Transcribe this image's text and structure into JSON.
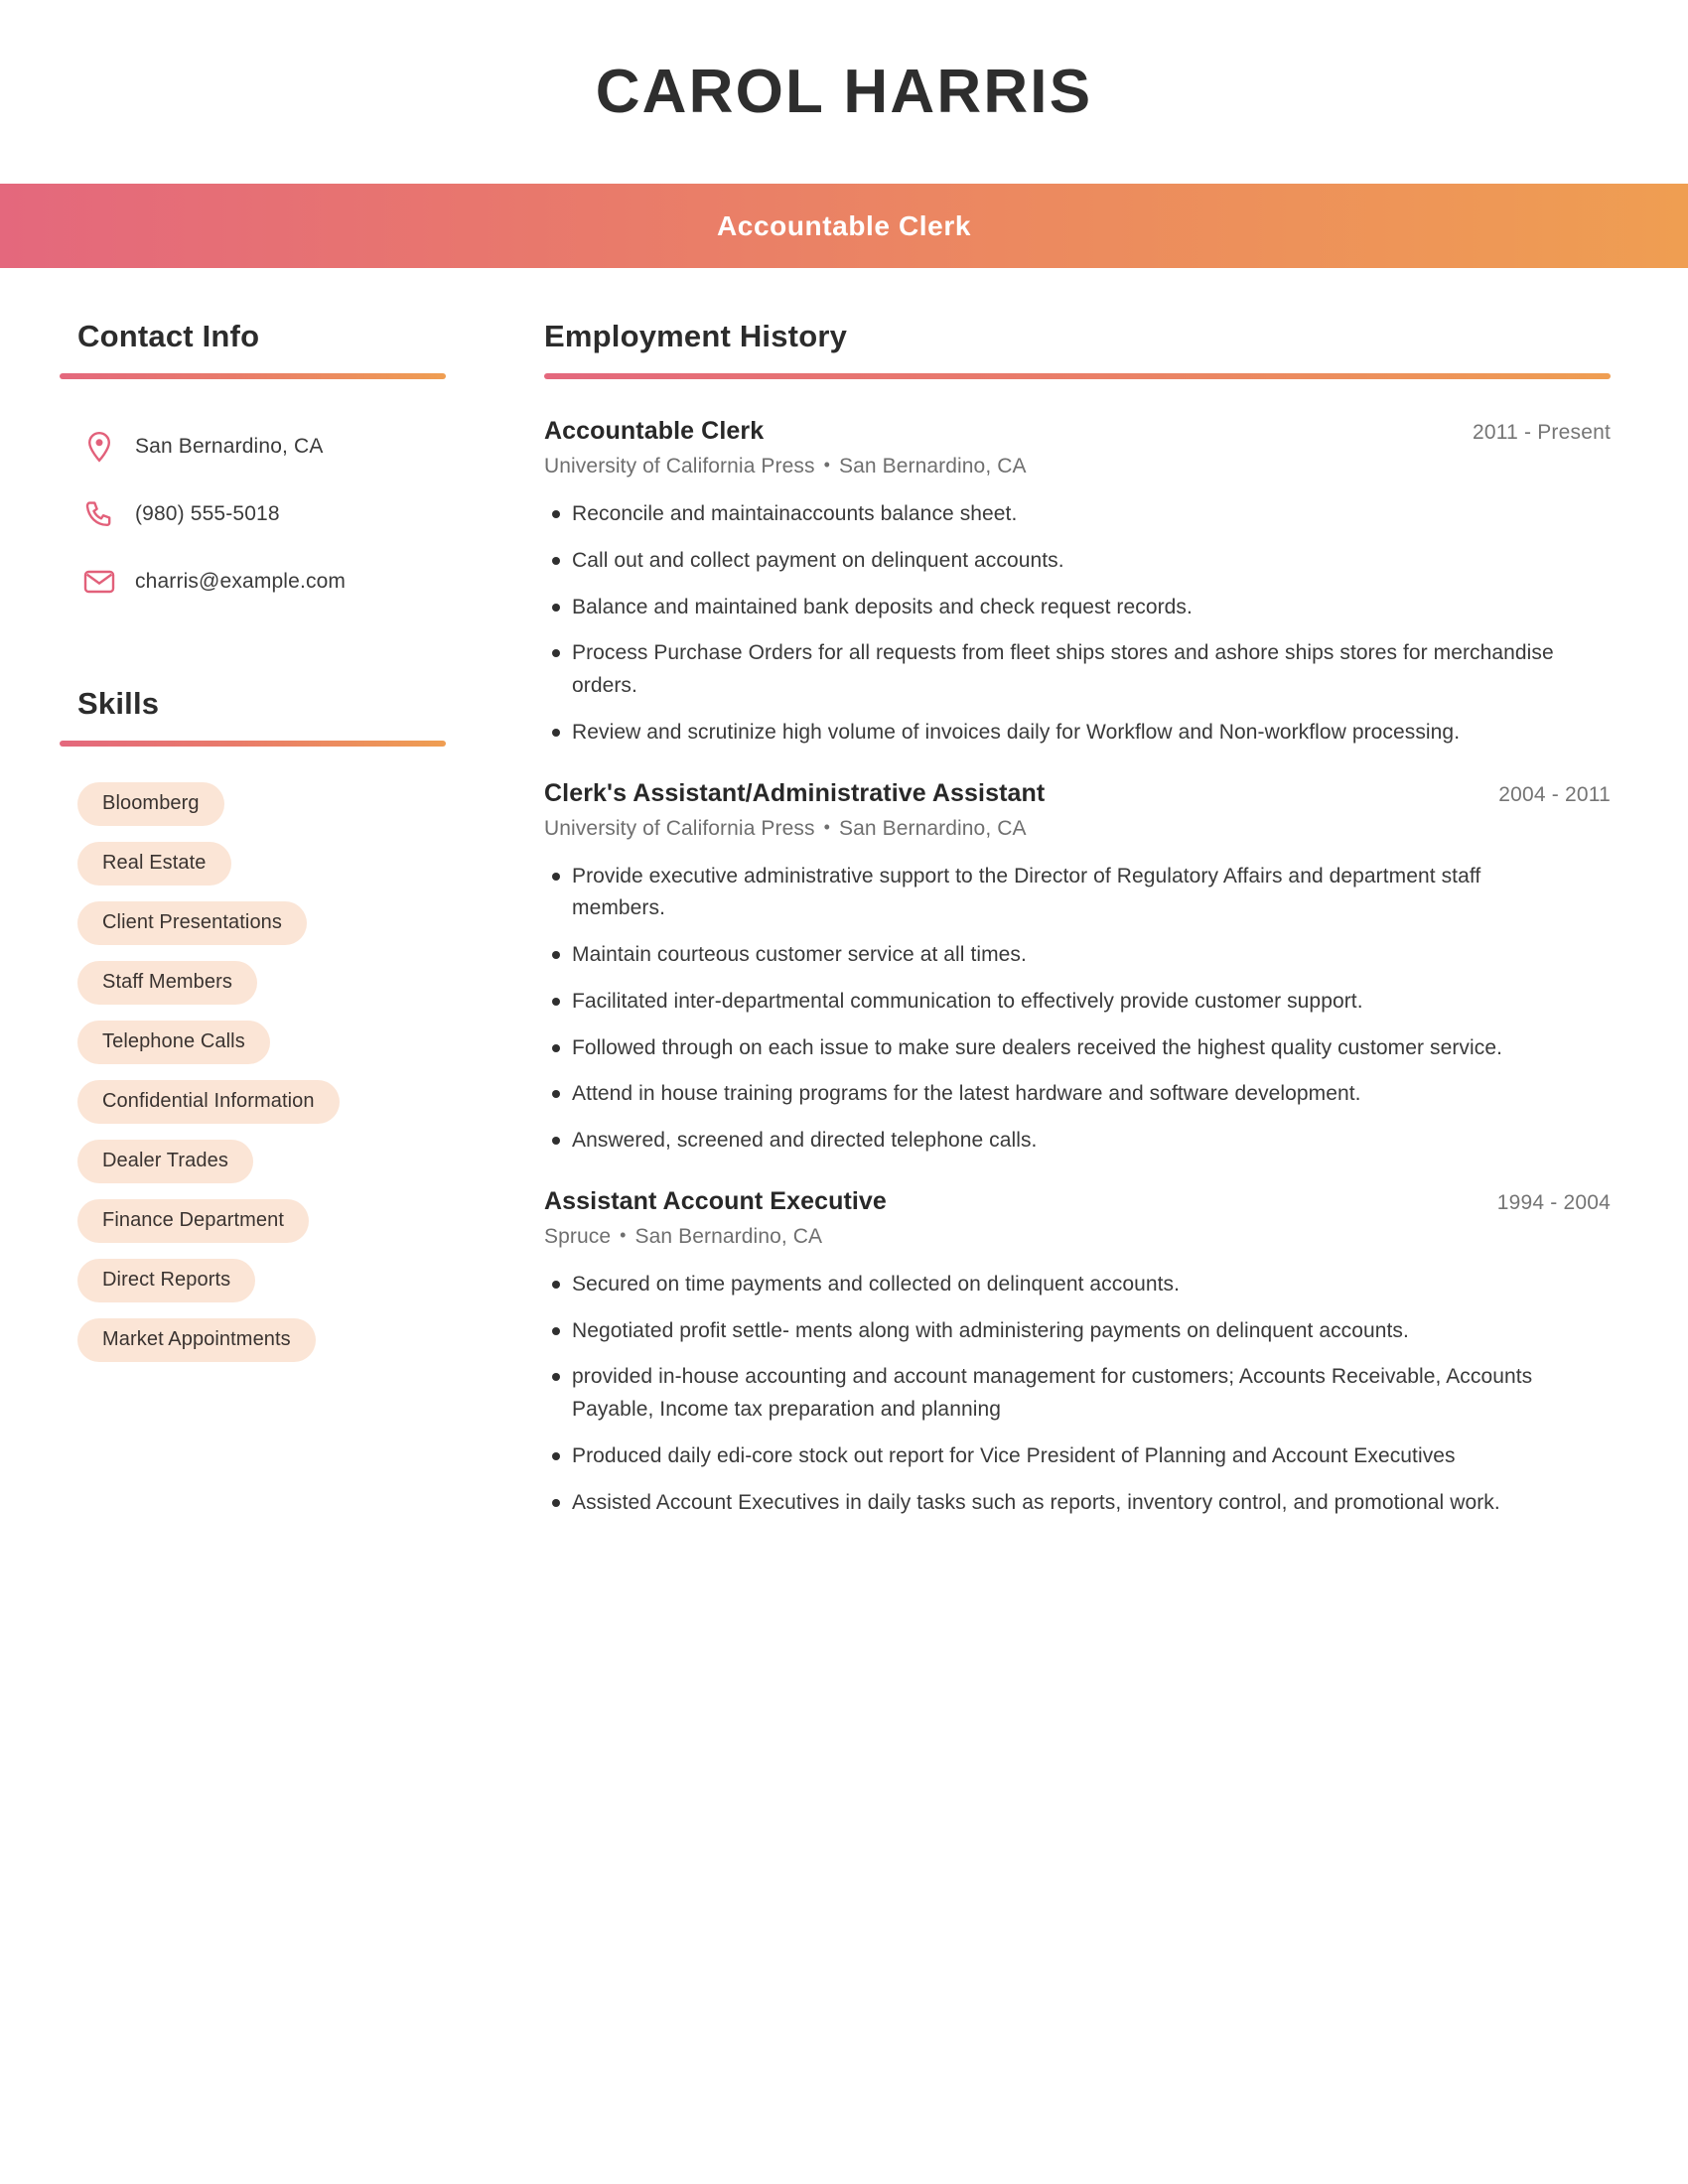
{
  "header": {
    "full_name": "CAROL HARRIS",
    "job_title": "Accountable Clerk",
    "accent_start": "#e4687d",
    "accent_end": "#ef9e52"
  },
  "sidebar": {
    "contact": {
      "heading": "Contact Info",
      "items": [
        {
          "icon": "location-pin-icon",
          "value": "San Bernardino, CA"
        },
        {
          "icon": "phone-icon",
          "value": "(980) 555-5018"
        },
        {
          "icon": "envelope-icon",
          "value": "charris@example.com"
        }
      ]
    },
    "skills": {
      "heading": "Skills",
      "pill_bg": "#fbe5d6",
      "items": [
        "Bloomberg",
        "Real Estate",
        "Client Presentations",
        "Staff Members",
        "Telephone Calls",
        "Confidential Information",
        "Dealer Trades",
        "Finance Department",
        "Direct Reports",
        "Market Appointments"
      ]
    }
  },
  "main": {
    "employment": {
      "heading": "Employment History",
      "separator": "•",
      "jobs": [
        {
          "role": "Accountable Clerk",
          "dates": "2011 - Present",
          "company": "University of California Press",
          "location": "San Bernardino, CA",
          "bullets": [
            "Reconcile and maintainaccounts balance sheet.",
            "Call out and collect payment on delinquent accounts.",
            "Balance and maintained bank deposits and check request records.",
            "Process Purchase Orders for all requests from fleet ships stores and ashore ships stores for merchandise orders.",
            "Review and scrutinize high volume of invoices daily for Workflow and Non-workflow processing."
          ]
        },
        {
          "role": "Clerk's Assistant/Administrative Assistant",
          "dates": "2004 - 2011",
          "company": "University of California Press",
          "location": "San Bernardino, CA",
          "bullets": [
            "Provide executive administrative support to the Director of Regulatory Affairs and department staff members.",
            "Maintain courteous customer service at all times.",
            "Facilitated inter-departmental communication to effectively provide customer support.",
            "Followed through on each issue to make sure dealers received the highest quality customer service.",
            "Attend in house training programs for the latest hardware and software development.",
            "Answered, screened and directed telephone calls."
          ]
        },
        {
          "role": "Assistant Account Executive",
          "dates": "1994 - 2004",
          "company": "Spruce",
          "location": "San Bernardino, CA",
          "bullets": [
            "Secured on time payments and collected on delinquent accounts.",
            "Negotiated profit settle- ments along with administering payments on delinquent accounts.",
            "provided in-house accounting and account management for customers; Accounts Receivable, Accounts Payable, Income tax preparation and planning",
            "Produced daily edi-core stock out report for Vice President of Planning and Account Executives",
            "Assisted Account Executives in daily tasks such as reports, inventory control, and promotional work."
          ]
        }
      ]
    }
  }
}
